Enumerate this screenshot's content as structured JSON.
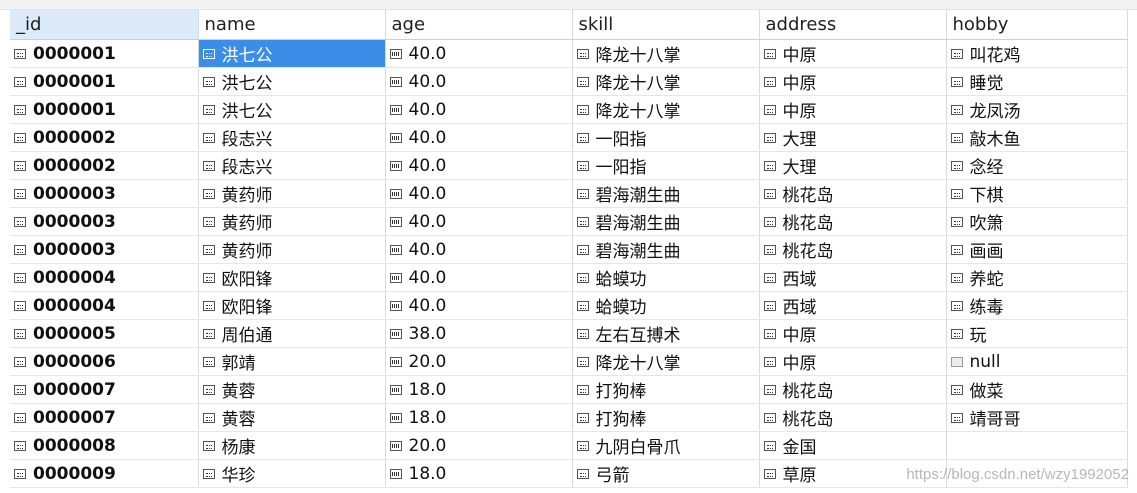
{
  "columns": [
    "_id",
    "name",
    "age",
    "skill",
    "address",
    "hobby"
  ],
  "rows": [
    [
      "0000001",
      "洪七公",
      "40.0",
      "降龙十八掌",
      "中原",
      "叫花鸡"
    ],
    [
      "0000001",
      "洪七公",
      "40.0",
      "降龙十八掌",
      "中原",
      "睡觉"
    ],
    [
      "0000001",
      "洪七公",
      "40.0",
      "降龙十八掌",
      "中原",
      "龙凤汤"
    ],
    [
      "0000002",
      "段志兴",
      "40.0",
      "一阳指",
      "大理",
      "敲木鱼"
    ],
    [
      "0000002",
      "段志兴",
      "40.0",
      "一阳指",
      "大理",
      "念经"
    ],
    [
      "0000003",
      "黄药师",
      "40.0",
      "碧海潮生曲",
      "桃花岛",
      "下棋"
    ],
    [
      "0000003",
      "黄药师",
      "40.0",
      "碧海潮生曲",
      "桃花岛",
      "吹箫"
    ],
    [
      "0000003",
      "黄药师",
      "40.0",
      "碧海潮生曲",
      "桃花岛",
      "画画"
    ],
    [
      "0000004",
      "欧阳锋",
      "40.0",
      "蛤蟆功",
      "西域",
      "养蛇"
    ],
    [
      "0000004",
      "欧阳锋",
      "40.0",
      "蛤蟆功",
      "西域",
      "练毒"
    ],
    [
      "0000005",
      "周伯通",
      "38.0",
      "左右互搏术",
      "中原",
      "玩"
    ],
    [
      "0000006",
      "郭靖",
      "20.0",
      "降龙十八掌",
      "中原",
      "null"
    ],
    [
      "0000007",
      "黄蓉",
      "18.0",
      "打狗棒",
      "桃花岛",
      "做菜"
    ],
    [
      "0000007",
      "黄蓉",
      "18.0",
      "打狗棒",
      "桃花岛",
      "靖哥哥"
    ],
    [
      "0000008",
      "杨康",
      "20.0",
      "九阴白骨爪",
      "金国",
      ""
    ],
    [
      "0000009",
      "华珍",
      "18.0",
      "弓箭",
      "草原",
      ""
    ]
  ],
  "cell_types": [
    "string",
    "string",
    "number",
    "string",
    "string",
    "string"
  ],
  "icons": {
    "string": "string-field-icon",
    "number": "number-field-icon",
    "null": "null-field-icon"
  },
  "selected_cell": {
    "row": 0,
    "col": 1
  },
  "colors": {
    "selection": "#3b8ee8",
    "active_header": "#dcebf9"
  },
  "watermark": "https://blog.csdn.net/wzy1992052"
}
